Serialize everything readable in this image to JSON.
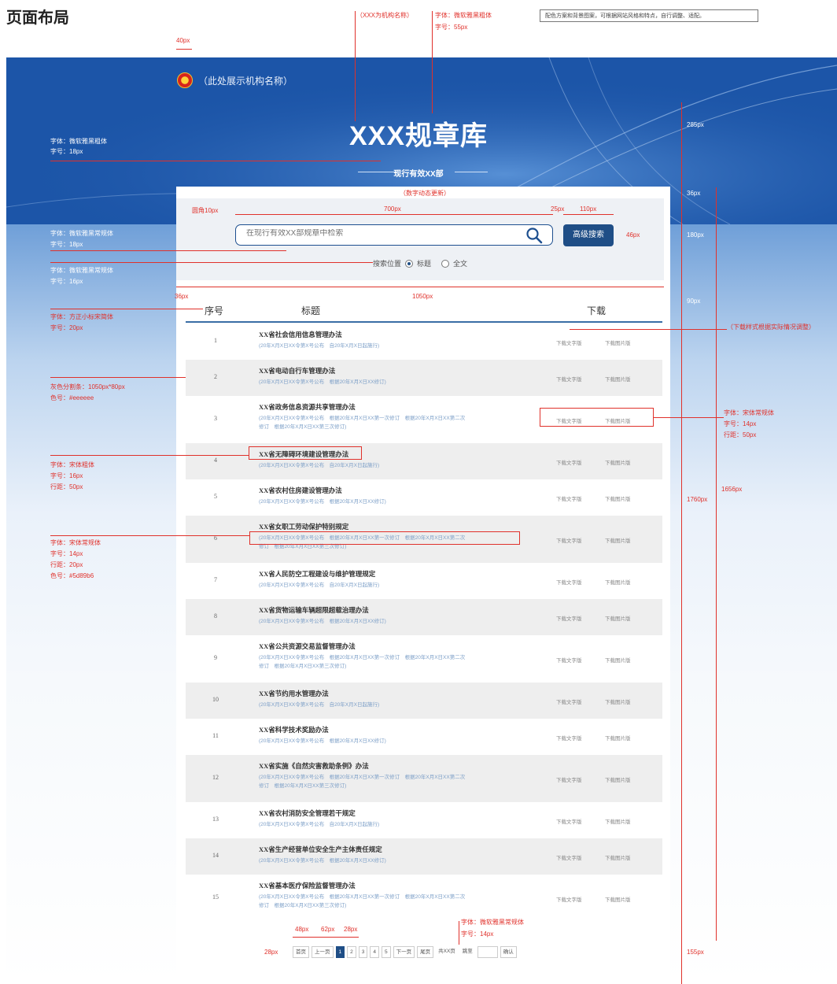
{
  "page_heading": "页面布局",
  "hero": {
    "org_name": "（此处展示机构名称）",
    "site_title": "XXX规章库",
    "subtitle": "现行有效XX部"
  },
  "search": {
    "placeholder": "在现行有效XX部规章中检索",
    "advanced_button": "高级搜索",
    "scope_label": "搜索位置",
    "scope_options": [
      "标题",
      "全文"
    ],
    "scope_selected": "标题"
  },
  "table": {
    "headers": [
      "序号",
      "标题",
      "下载"
    ],
    "download_labels": [
      "下载文字版",
      "下载图片版"
    ],
    "rows": [
      {
        "num": "1",
        "title": "XX省社会信用信息管理办法",
        "meta": [
          "(20年X月X日XX令第X号公布　自20年X月X日起施行)"
        ]
      },
      {
        "num": "2",
        "title": "XX省电动自行车管理办法",
        "meta": [
          "(20年X月X日XX令第X号公布　根据20年X月X日XX修订)"
        ]
      },
      {
        "num": "3",
        "title": "XX省政务信息资源共享管理办法",
        "meta": [
          "(20年X月X日XX令第X号公布　根据20年X月X日XX第一次修订　根据20年X月X日XX第二次",
          "修订　根据20年X月X日XX第三次修订)"
        ]
      },
      {
        "num": "4",
        "title": "XX省无障碍环境建设管理办法",
        "meta": [
          "(20年X月X日XX令第X号公布　自20年X月X日起施行)"
        ]
      },
      {
        "num": "5",
        "title": "XX省农村住房建设管理办法",
        "meta": [
          "(20年X月X日XX令第X号公布　根据20年X月X日XX修订)"
        ]
      },
      {
        "num": "6",
        "title": "XX省女职工劳动保护特别规定",
        "meta": [
          "(20年X月X日XX令第X号公布　根据20年X月X日XX第一次修订　根据20年X月X日XX第二次",
          "修订　根据20年X月X日XX第三次修订)"
        ]
      },
      {
        "num": "7",
        "title": "XX省人民防空工程建设与维护管理规定",
        "meta": [
          "(20年X月X日XX令第X号公布　自20年X月X日起施行)"
        ]
      },
      {
        "num": "8",
        "title": "XX省货物运输车辆超限超载治理办法",
        "meta": [
          "(20年X月X日XX令第X号公布　根据20年X月X日XX修订)"
        ]
      },
      {
        "num": "9",
        "title": "XX省公共资源交易监督管理办法",
        "meta": [
          "(20年X月X日XX令第X号公布　根据20年X月X日XX第一次修订　根据20年X月X日XX第二次",
          "修订　根据20年X月X日XX第三次修订)"
        ]
      },
      {
        "num": "10",
        "title": "XX省节约用水管理办法",
        "meta": [
          "(20年X月X日XX令第X号公布　自20年X月X日起施行)"
        ]
      },
      {
        "num": "11",
        "title": "XX省科学技术奖励办法",
        "meta": [
          "(20年X月X日XX令第X号公布　根据20年X月X日XX修订)"
        ]
      },
      {
        "num": "12",
        "title": "XX省实施《自然灾害救助条例》办法",
        "meta": [
          "(20年X月X日XX令第X号公布　根据20年X月X日XX第一次修订　根据20年X月X日XX第二次",
          "修订　根据20年X月X日XX第三次修订)"
        ]
      },
      {
        "num": "13",
        "title": "XX省农村消防安全管理若干规定",
        "meta": [
          "(20年X月X日XX令第X号公布　自20年X月X日起施行)"
        ]
      },
      {
        "num": "14",
        "title": "XX省生产经营单位安全生产主体责任规定",
        "meta": [
          "(20年X月X日XX令第X号公布　根据20年X月X日XX修订)"
        ]
      },
      {
        "num": "15",
        "title": "XX省基本医疗保险监督管理办法",
        "meta": [
          "(20年X月X日XX令第X号公布　根据20年X月X日XX第一次修订　根据20年X月X日XX第二次",
          "修订　根据20年X月X日XX第三次修订)"
        ]
      }
    ]
  },
  "pager": {
    "first": "首页",
    "prev": "上一页",
    "pages": [
      "1",
      "2",
      "3",
      "4",
      "5"
    ],
    "current": "1",
    "next": "下一页",
    "last": "尾页",
    "total": "共XX页",
    "goto": "跳至",
    "confirm": "确认"
  },
  "annotations": {
    "org_name_label": "（XXX为机构名称）",
    "title_font": "字体：微软雅黑粗体",
    "title_size": "字号：55px",
    "color_note": "配色方案和背景图案，可根据网站风格和特点，自行调整、适配。",
    "left_40": "40px",
    "sub_font": "字体：微软雅黑粗体",
    "sub_size": "字号：18px",
    "sub_note": "（数字动态更新）",
    "radius": "圆角10px",
    "w700": "700px",
    "w25": "25px",
    "w110": "110px",
    "h46": "46px",
    "search_font": "字体：微软雅黑常规体",
    "search_size": "字号：18px",
    "scope_font": "字体：微软雅黑常规体",
    "scope_size": "字号：16px",
    "w36": "36px",
    "w1050": "1050px",
    "head_font": "字体：方正小标宋简体",
    "head_size": "字号：20px",
    "gray_divider": "灰色分割条：1050px*80px",
    "gray_color": "色号：#eeeeee",
    "download_note": "（下载样式根据实际情况调整）",
    "dl_font": "字体：宋体常规体",
    "dl_size": "字号：14px",
    "dl_line": "行距：50px",
    "title_row_font": "字体：宋体粗体",
    "title_row_size": "字号：16px",
    "title_row_line": "行距：50px",
    "meta_font": "字体：宋体常规体",
    "meta_size": "字号：14px",
    "meta_line": "行距：20px",
    "meta_color": "色号：#5d89b6",
    "r285": "285px",
    "r36": "36px",
    "r180": "180px",
    "r90": "90px",
    "r1656": "1656px",
    "r1760": "1760px",
    "r155": "155px",
    "p48": "48px",
    "p62": "62px",
    "p28a": "28px",
    "p28b": "28px",
    "pager_font": "字体：微软雅黑常规体",
    "pager_size": "字号：14px"
  },
  "colors": {
    "brand": "#1f4e86",
    "gray_row": "#eeeeee",
    "meta": "#5d89b6",
    "annotation": "#e0312b"
  }
}
